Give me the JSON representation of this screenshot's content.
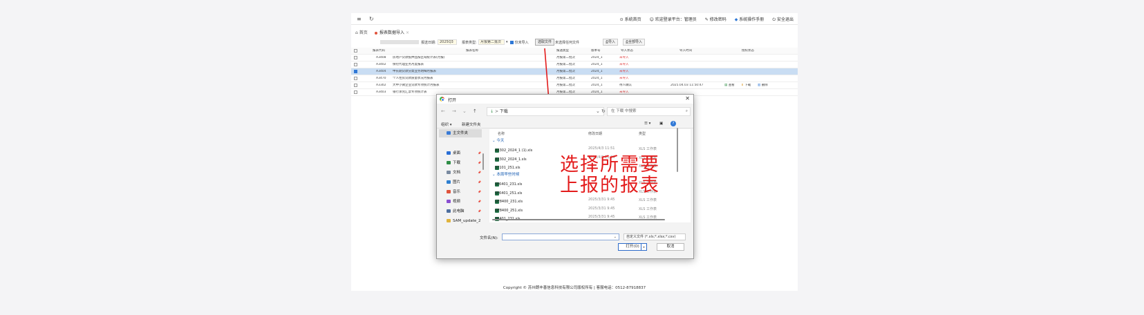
{
  "topbar": {
    "menu_icon": "≡",
    "refresh_icon": "↻",
    "nav": [
      {
        "icon": "⊙",
        "label": "系统首页"
      },
      {
        "icon": "☺",
        "label": "欢迎登录平台：管理员"
      },
      {
        "icon": "✎",
        "label": "修改密码"
      },
      {
        "icon": "◆",
        "label": "系统操作手册"
      },
      {
        "icon": "⏻",
        "label": "安全退出"
      }
    ]
  },
  "tabs": [
    {
      "icon": "⌂",
      "label": "首页"
    },
    {
      "label": "报表数据导入",
      "close": "×"
    }
  ],
  "toolbar": {
    "period_label": "报送日期:",
    "period_value": "2025Q3",
    "type_label": "报表类型:",
    "type_value": "月报第二批次",
    "chk_label": "仅未导入",
    "choose_btn": "选取文件",
    "no_file": "未选择任何文件",
    "import_btn": "导入",
    "import_all_btn": "全部导入"
  },
  "table": {
    "headers": [
      "报表代码",
      "报表名称",
      "报送类型",
      "版本号",
      "导入状态",
      "导入时间",
      "授权状态"
    ],
    "rows": [
      {
        "code": "A3408",
        "name": "房地产贷款抵押品按区域统计表(月报)",
        "type": "月报第二批次",
        "ver": "2024_1",
        "status": "未导入",
        "time": "",
        "sel": false,
        "actions": []
      },
      {
        "code": "A3402",
        "name": "保险代理业务月度报表",
        "type": "月报第二批次",
        "ver": "2024_1",
        "status": "未导入",
        "time": "",
        "sel": false,
        "actions": []
      },
      {
        "code": "A3404",
        "name": "中长期贷款分类业务明细月报表",
        "type": "月报第二批次",
        "ver": "2024_1",
        "status": "未导入",
        "time": "",
        "sel": true,
        "actions": []
      },
      {
        "code": "A3470",
        "name": "个人住房贷款质量状况月报表",
        "type": "月报第二批次",
        "ver": "2024_1",
        "status": "未导入",
        "time": "",
        "sel": false,
        "actions": []
      },
      {
        "code": "A3302",
        "name": "大中小微企业贷款专项统计月报表",
        "type": "月报第二批次",
        "ver": "2024_1",
        "status": "待人确认",
        "time": "2025.04.03 11:50:47",
        "sel": false,
        "actions": [
          "查看",
          "下载",
          "删除"
        ]
      },
      {
        "code": "A3403",
        "name": "银行承兑汇票专项统计表",
        "type": "月报第二批次",
        "ver": "2024_1",
        "status": "未导入",
        "time": "",
        "sel": false,
        "actions": []
      }
    ]
  },
  "footer": "Copyright © 苏州朗丰善信息科技有限公司版权所有 | 客服电话：0512-87918837",
  "dialog": {
    "title": "打开",
    "close": "✕",
    "address": "下载",
    "search_placeholder": "在 下载 中搜索",
    "organize": "组织 ▾",
    "new_folder": "新建文件夹",
    "nav": [
      {
        "label": "主文件夹",
        "color": "#3a7bd5",
        "sel": true
      },
      {
        "label": "桌面",
        "color": "#2b6fd6"
      },
      {
        "label": "下载",
        "color": "#2f8d46"
      },
      {
        "label": "文档",
        "color": "#7a8aa0"
      },
      {
        "label": "图片",
        "color": "#2f7fd0"
      },
      {
        "label": "音乐",
        "color": "#e0533c"
      },
      {
        "label": "视频",
        "color": "#8a4fd1"
      },
      {
        "label": "此电脑",
        "color": "#4f6f9f"
      },
      {
        "label": "SAM_update_2",
        "color": "#e0b33c"
      }
    ],
    "col_name": "名称",
    "col_date": "修改日期",
    "col_type": "类型",
    "group_today": "今天",
    "group_earlier": "本周早些时候",
    "files_today": [
      {
        "name": "A3302_2024_1 (1).xls",
        "date": "2025/4/3 11:51",
        "type": "XLS 工作表"
      },
      {
        "name": "A3302_2024_1.xls",
        "date": "2025/4/3 11:24",
        "type": "XLS 工作表"
      },
      {
        "name": "S7101_251.xls",
        "date": "",
        "type": "XLS 工作表"
      }
    ],
    "files_earlier": [
      {
        "name": "SF6401_231.xls",
        "date": "",
        "type": "XLS 工作表"
      },
      {
        "name": "SF6401_251.xls",
        "date": "",
        "type": "XLS 工作表"
      },
      {
        "name": "GF8400_231.xls",
        "date": "2025/3/31 9:45",
        "type": "XLS 工作表"
      },
      {
        "name": "GF8400_251.xls",
        "date": "2025/3/31 9:45",
        "type": "XLS 工作表"
      },
      {
        "name": "S6401_231.xls",
        "date": "2025/3/31 9:45",
        "type": "XLS 工作表"
      }
    ],
    "filename_label": "文件名(N):",
    "filter": "自定义文件 (*.xls;*.xlsx;*.csv)",
    "open_btn": "打开(O)",
    "cancel_btn": "取消"
  },
  "annotation": [
    "选择所需要",
    "上报的报表"
  ]
}
